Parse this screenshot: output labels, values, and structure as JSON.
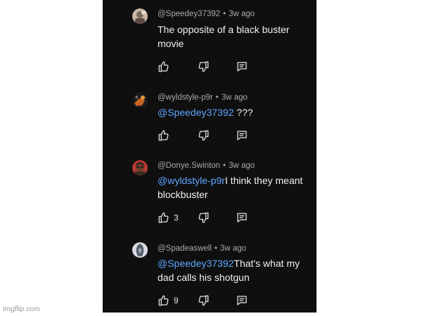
{
  "watermark": "imgflip.com",
  "comments": [
    {
      "author": "@Speedey37392",
      "separator": "•",
      "time": "3w ago",
      "mention": "",
      "text": "The opposite of a black buster movie",
      "likes": ""
    },
    {
      "author": "@wyldstyle-p9r",
      "separator": "•",
      "time": "3w ago",
      "mention": "@Speedey37392",
      "text": " ???",
      "likes": ""
    },
    {
      "author": "@Donye.Swinton",
      "separator": "•",
      "time": "3w ago",
      "mention": "@wyldstyle-p9r",
      "text": "I think they meant blockbuster",
      "likes": "3"
    },
    {
      "author": "@Spadeaswell",
      "separator": "•",
      "time": "3w ago",
      "mention": "@Speedey37392",
      "text": "That's what my dad calls his shotgun",
      "likes": "9"
    }
  ],
  "icons": {
    "like": "thumbs-up-icon",
    "dislike": "thumbs-down-icon",
    "reply": "reply-icon"
  },
  "colors": {
    "panel_background": "#0f0f0f",
    "mention": "#5ea5ff",
    "meta_text": "#a9a9a9",
    "body_text": "#f1f1f1"
  }
}
